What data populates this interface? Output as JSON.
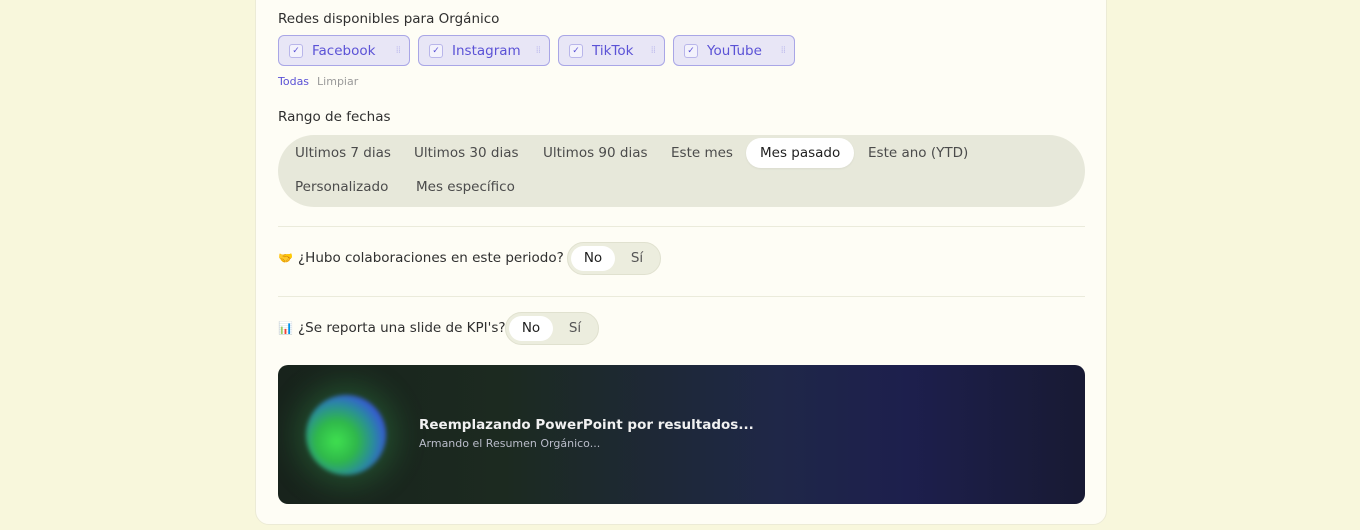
{
  "networks": {
    "label": "Redes disponibles para Orgánico",
    "chips": [
      {
        "label": "Facebook",
        "checked": true
      },
      {
        "label": "Instagram",
        "checked": true
      },
      {
        "label": "TikTok",
        "checked": true
      },
      {
        "label": "YouTube",
        "checked": true
      }
    ],
    "check_glyph": "✓",
    "grip_glyph": "⁞⁞",
    "select_all": "Todas",
    "clear": "Limpiar"
  },
  "date_range": {
    "label": "Rango de fechas",
    "options": [
      {
        "label": "Ultimos 7 dias"
      },
      {
        "label": "Ultimos 30 dias"
      },
      {
        "label": "Ultimos 90 dias"
      },
      {
        "label": "Este mes"
      },
      {
        "label": "Mes pasado",
        "selected": true
      },
      {
        "label": "Este ano (YTD)"
      },
      {
        "label": "Personalizado"
      },
      {
        "label": "Mes específico"
      }
    ]
  },
  "collaborations": {
    "icon": "handshake-icon",
    "icon_glyph": "🤝",
    "question": "¿Hubo colaboraciones en este periodo?",
    "no": "No",
    "yes": "Sí",
    "selected": "No"
  },
  "kpi": {
    "icon": "bar-chart-icon",
    "icon_glyph": "📊",
    "question": "¿Se reporta una slide de KPI's?",
    "no": "No",
    "yes": "Sí",
    "selected": "No"
  },
  "loader": {
    "title": "Reemplazando PowerPoint por resultados...",
    "subtitle": "Armando el Resumen Orgánico..."
  },
  "colors": {
    "accent": "#5b52d6",
    "page_bg": "#f8f7dc",
    "card_bg": "#fefdf5"
  }
}
